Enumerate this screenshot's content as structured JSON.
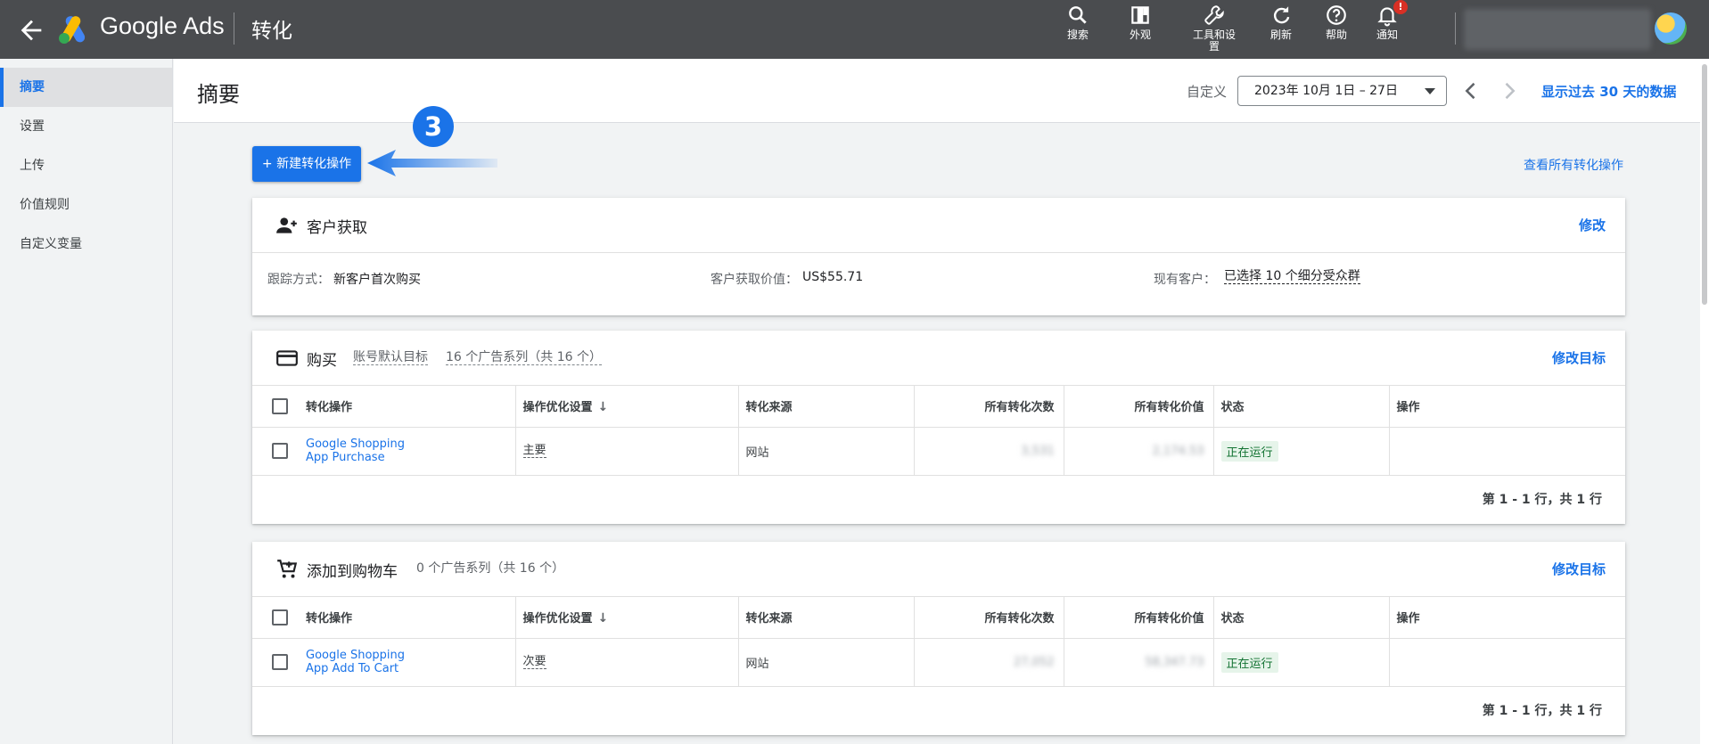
{
  "topbar": {
    "brand": "Google Ads",
    "page": "转化",
    "tools": [
      {
        "label": "搜索",
        "icon": "search-icon"
      },
      {
        "label": "外观",
        "icon": "appearance-icon"
      },
      {
        "label": "工具和设",
        "label2": "置",
        "icon": "wrench-icon"
      },
      {
        "label": "刷新",
        "icon": "refresh-icon"
      },
      {
        "label": "帮助",
        "icon": "help-icon"
      },
      {
        "label": "通知",
        "icon": "bell-icon",
        "badge": "!"
      }
    ]
  },
  "sidebar": {
    "items": [
      {
        "label": "摘要",
        "active": true
      },
      {
        "label": "设置"
      },
      {
        "label": "上传"
      },
      {
        "label": "价值规则"
      },
      {
        "label": "自定义变量"
      }
    ]
  },
  "header": {
    "title": "摘要",
    "custom_label": "自定义",
    "date_range": "2023年 10月 1日 – 27日",
    "show_last_30": "显示过去 30 天的数据"
  },
  "toolbar": {
    "new_conversion": "+ 新建转化操作",
    "step": "3",
    "view_all": "查看所有转化操作"
  },
  "acquisition": {
    "title": "客户获取",
    "edit": "修改",
    "tracking_label": "跟踪方式：",
    "tracking_value": "新客户首次购买",
    "value_label": "客户获取价值：",
    "value": "US$55.71",
    "existing_label": "现有客户：",
    "existing_value": "已选择 10 个细分受众群"
  },
  "table_headers": {
    "action": "转化操作",
    "optimization": "操作优化设置",
    "source": "转化来源",
    "all_conversions": "所有转化次数",
    "all_value": "所有转化价值",
    "status": "状态",
    "operations": "操作"
  },
  "purchase": {
    "title": "购买",
    "default_goal": "账号默认目标",
    "campaigns": "16 个广告系列（共 16 个）",
    "edit_goal": "修改目标",
    "rows": [
      {
        "name1": "Google Shopping",
        "name2": "App Purchase",
        "optimization": "主要",
        "source": "网站",
        "conversions": "3,531",
        "value": "2,174.53",
        "status": "正在运行"
      }
    ],
    "pager": "第 1 - 1 行，共 1 行"
  },
  "cart": {
    "title": "添加到购物车",
    "campaigns": "0 个广告系列（共 16 个）",
    "edit_goal": "修改目标",
    "rows": [
      {
        "name1": "Google Shopping",
        "name2": "App Add To Cart",
        "optimization": "次要",
        "source": "网站",
        "conversions": "27,052",
        "value": "58,347.73",
        "status": "正在运行"
      }
    ],
    "pager": "第 1 - 1 行，共 1 行"
  },
  "colors": {
    "accent": "#1a73e8",
    "topbar": "#4a4c4f",
    "status_bg": "#e6f4ea",
    "status_text": "#137333"
  }
}
